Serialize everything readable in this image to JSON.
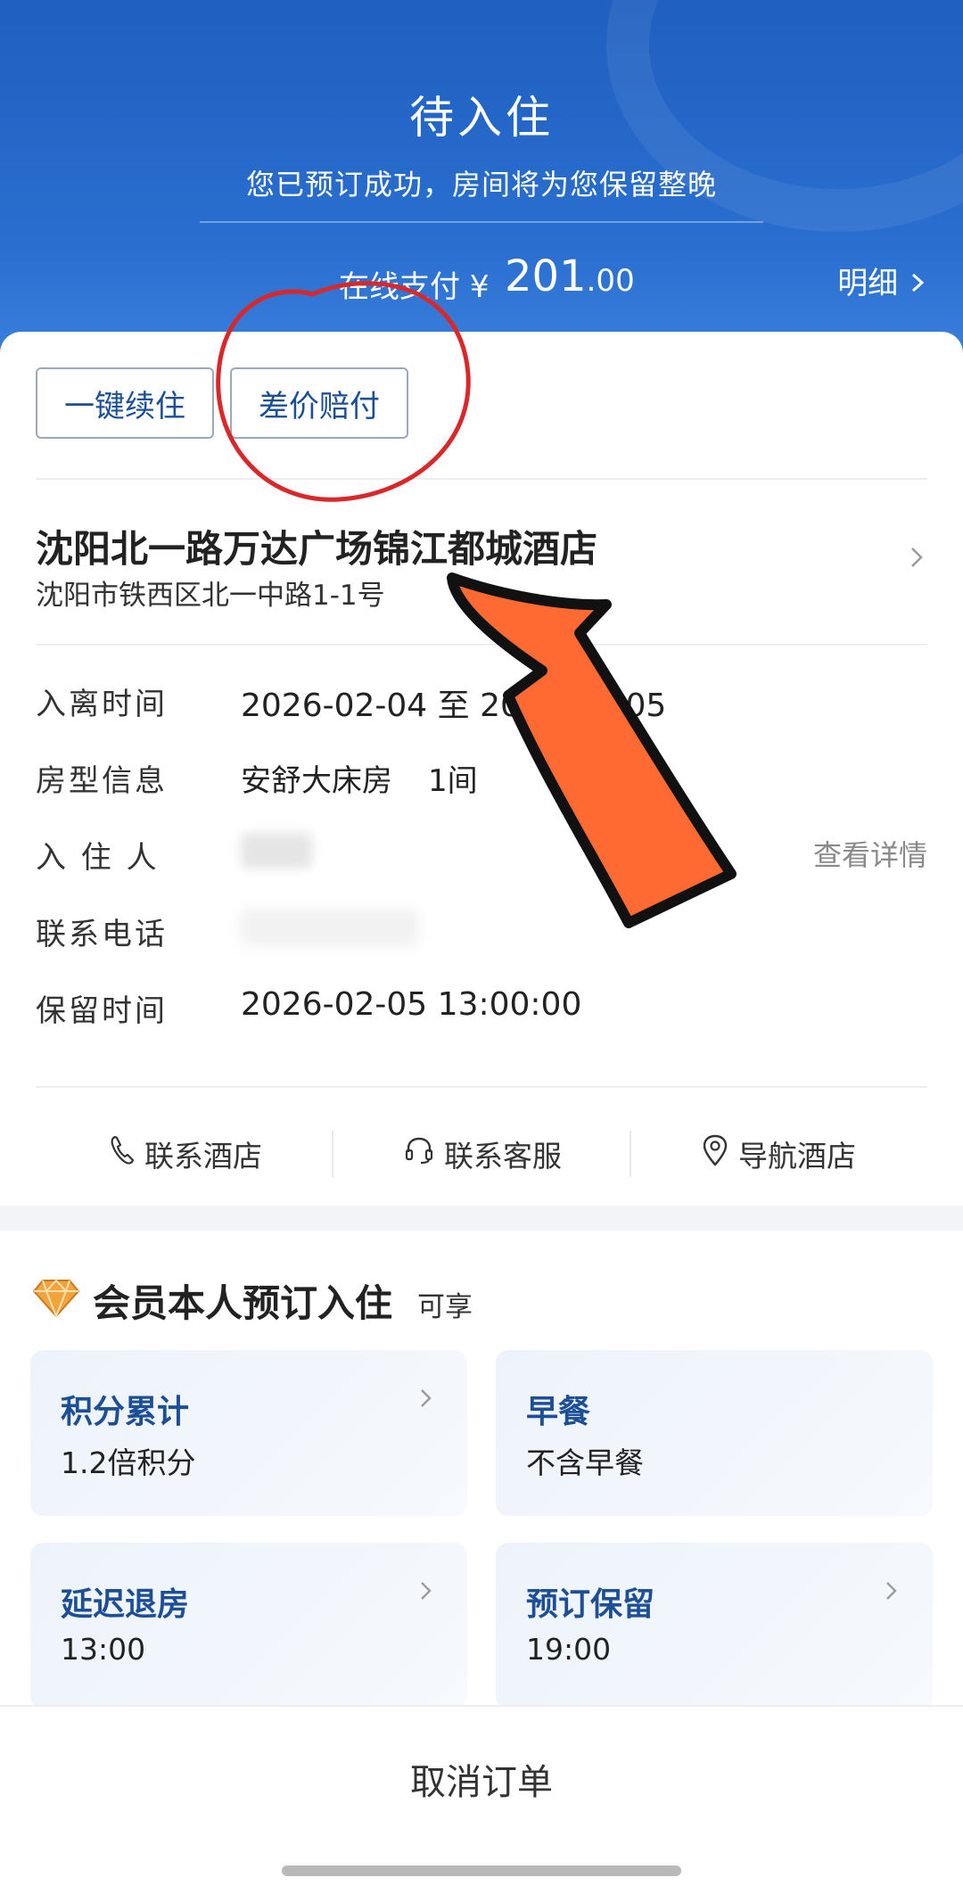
{
  "header": {
    "status_title": "待入住",
    "status_subtitle": "您已预订成功，房间将为您保留整晚",
    "pay_label": "在线支付",
    "pay_currency": "¥",
    "pay_amount_int": "201",
    "pay_amount_cents": ".00",
    "detail_link": "明细",
    "accent_color": "#2a6fd0"
  },
  "actions_top": {
    "renew": "一键续住",
    "price_diff": "差价赔付"
  },
  "hotel": {
    "name": "沈阳北一路万达广场锦江都城酒店",
    "address": "沈阳市铁西区北一中路1-1号"
  },
  "info": {
    "checkin_label": "入离时间",
    "checkin_value": "2026-02-04 至 2026-02-05",
    "room_label": "房型信息",
    "room_type": "安舒大床房",
    "room_count": "1间",
    "guest_label": "入 住 人",
    "guest_link": "查看详情",
    "phone_label": "联系电话",
    "hold_label": "保留时间",
    "hold_value": "2026-02-05 13:00:00"
  },
  "action_bar": {
    "call_hotel": "联系酒店",
    "call_service": "联系客服",
    "navigate": "导航酒店",
    "icons": [
      "phone-icon",
      "headset-icon",
      "location-pin-icon"
    ]
  },
  "member": {
    "title": "会员本人预订入住",
    "enjoy": "可享",
    "tiles": [
      {
        "title": "积分累计",
        "value": "1.2倍积分"
      },
      {
        "title": "早餐",
        "value": "不含早餐"
      },
      {
        "title": "延迟退房",
        "value": "13:00"
      },
      {
        "title": "预订保留",
        "value": "19:00"
      }
    ]
  },
  "bottom": {
    "cancel": "取消订单"
  },
  "annotation_colors": {
    "circle": "#d8282a",
    "arrow": "#ff6a33"
  }
}
